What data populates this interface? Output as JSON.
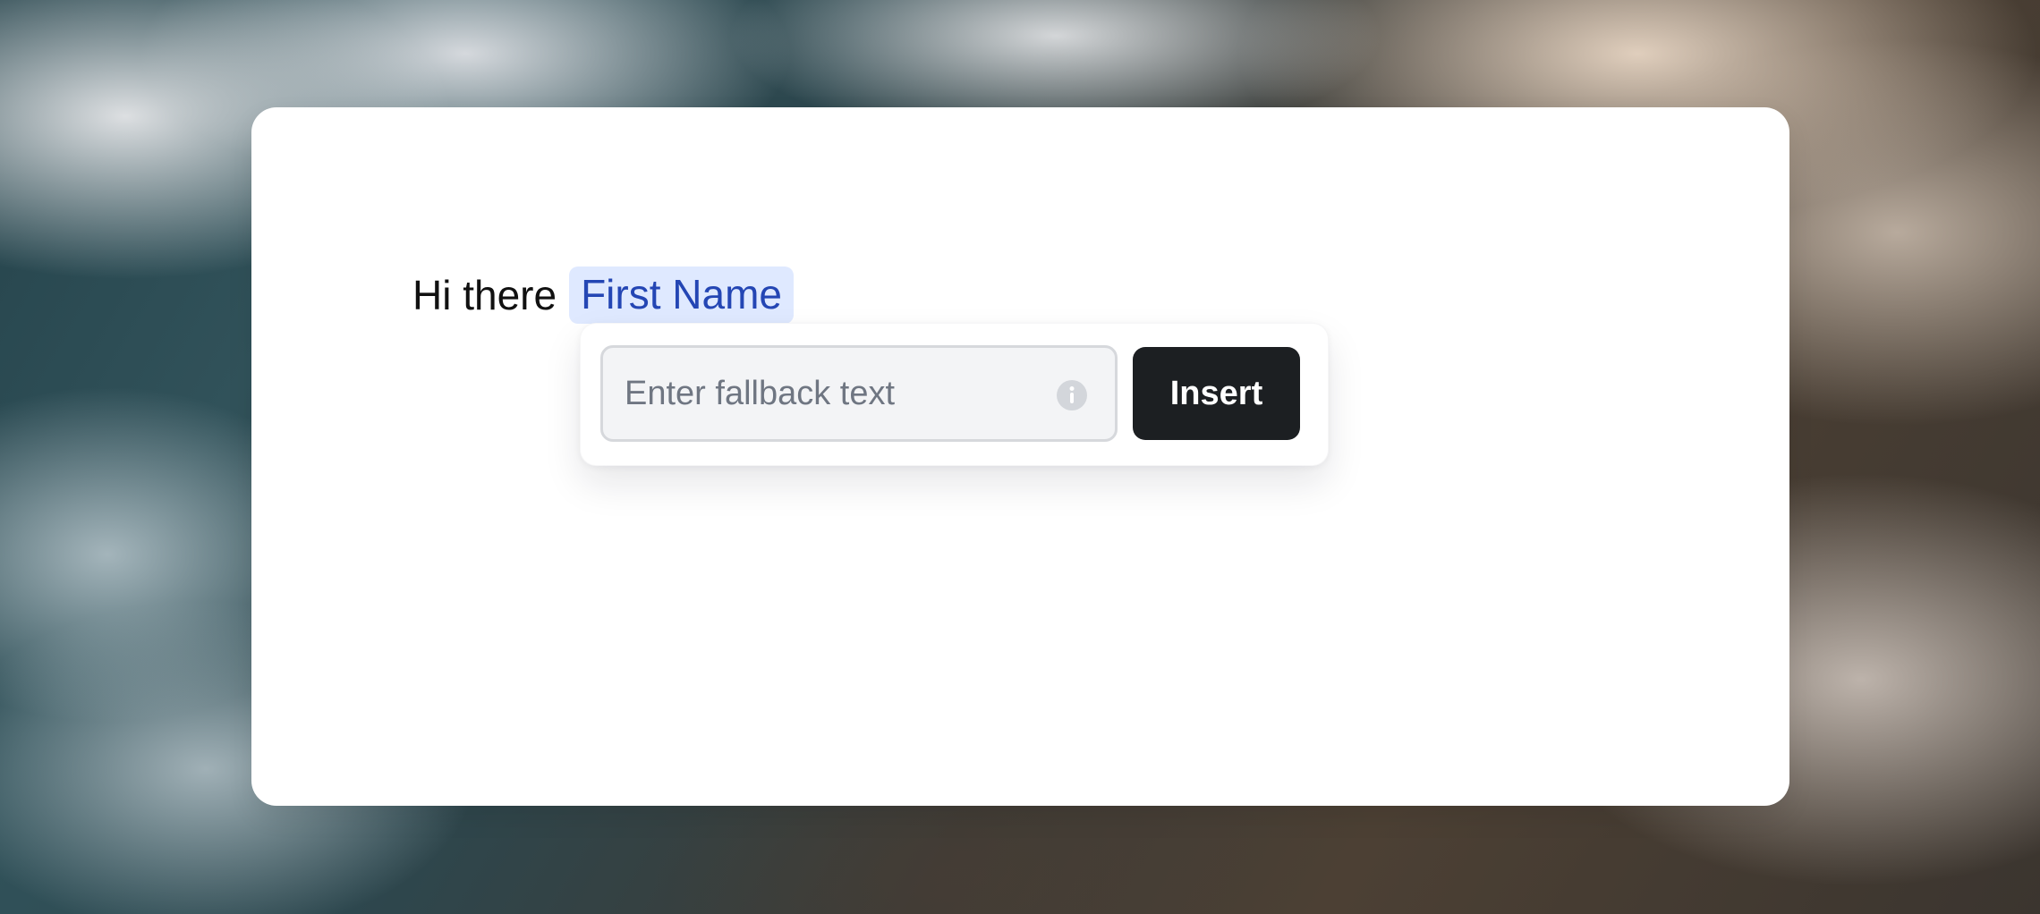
{
  "editor": {
    "greeting": "Hi there",
    "variable_chip": "First Name"
  },
  "fallback_popover": {
    "input": {
      "placeholder": "Enter fallback text",
      "value": ""
    },
    "info_icon": "info-icon",
    "insert_button_label": "Insert"
  },
  "colors": {
    "chip_background": "#dfe9ff",
    "chip_text": "#2446b4",
    "button_background": "#1c1f22",
    "input_background": "#f3f4f6"
  }
}
